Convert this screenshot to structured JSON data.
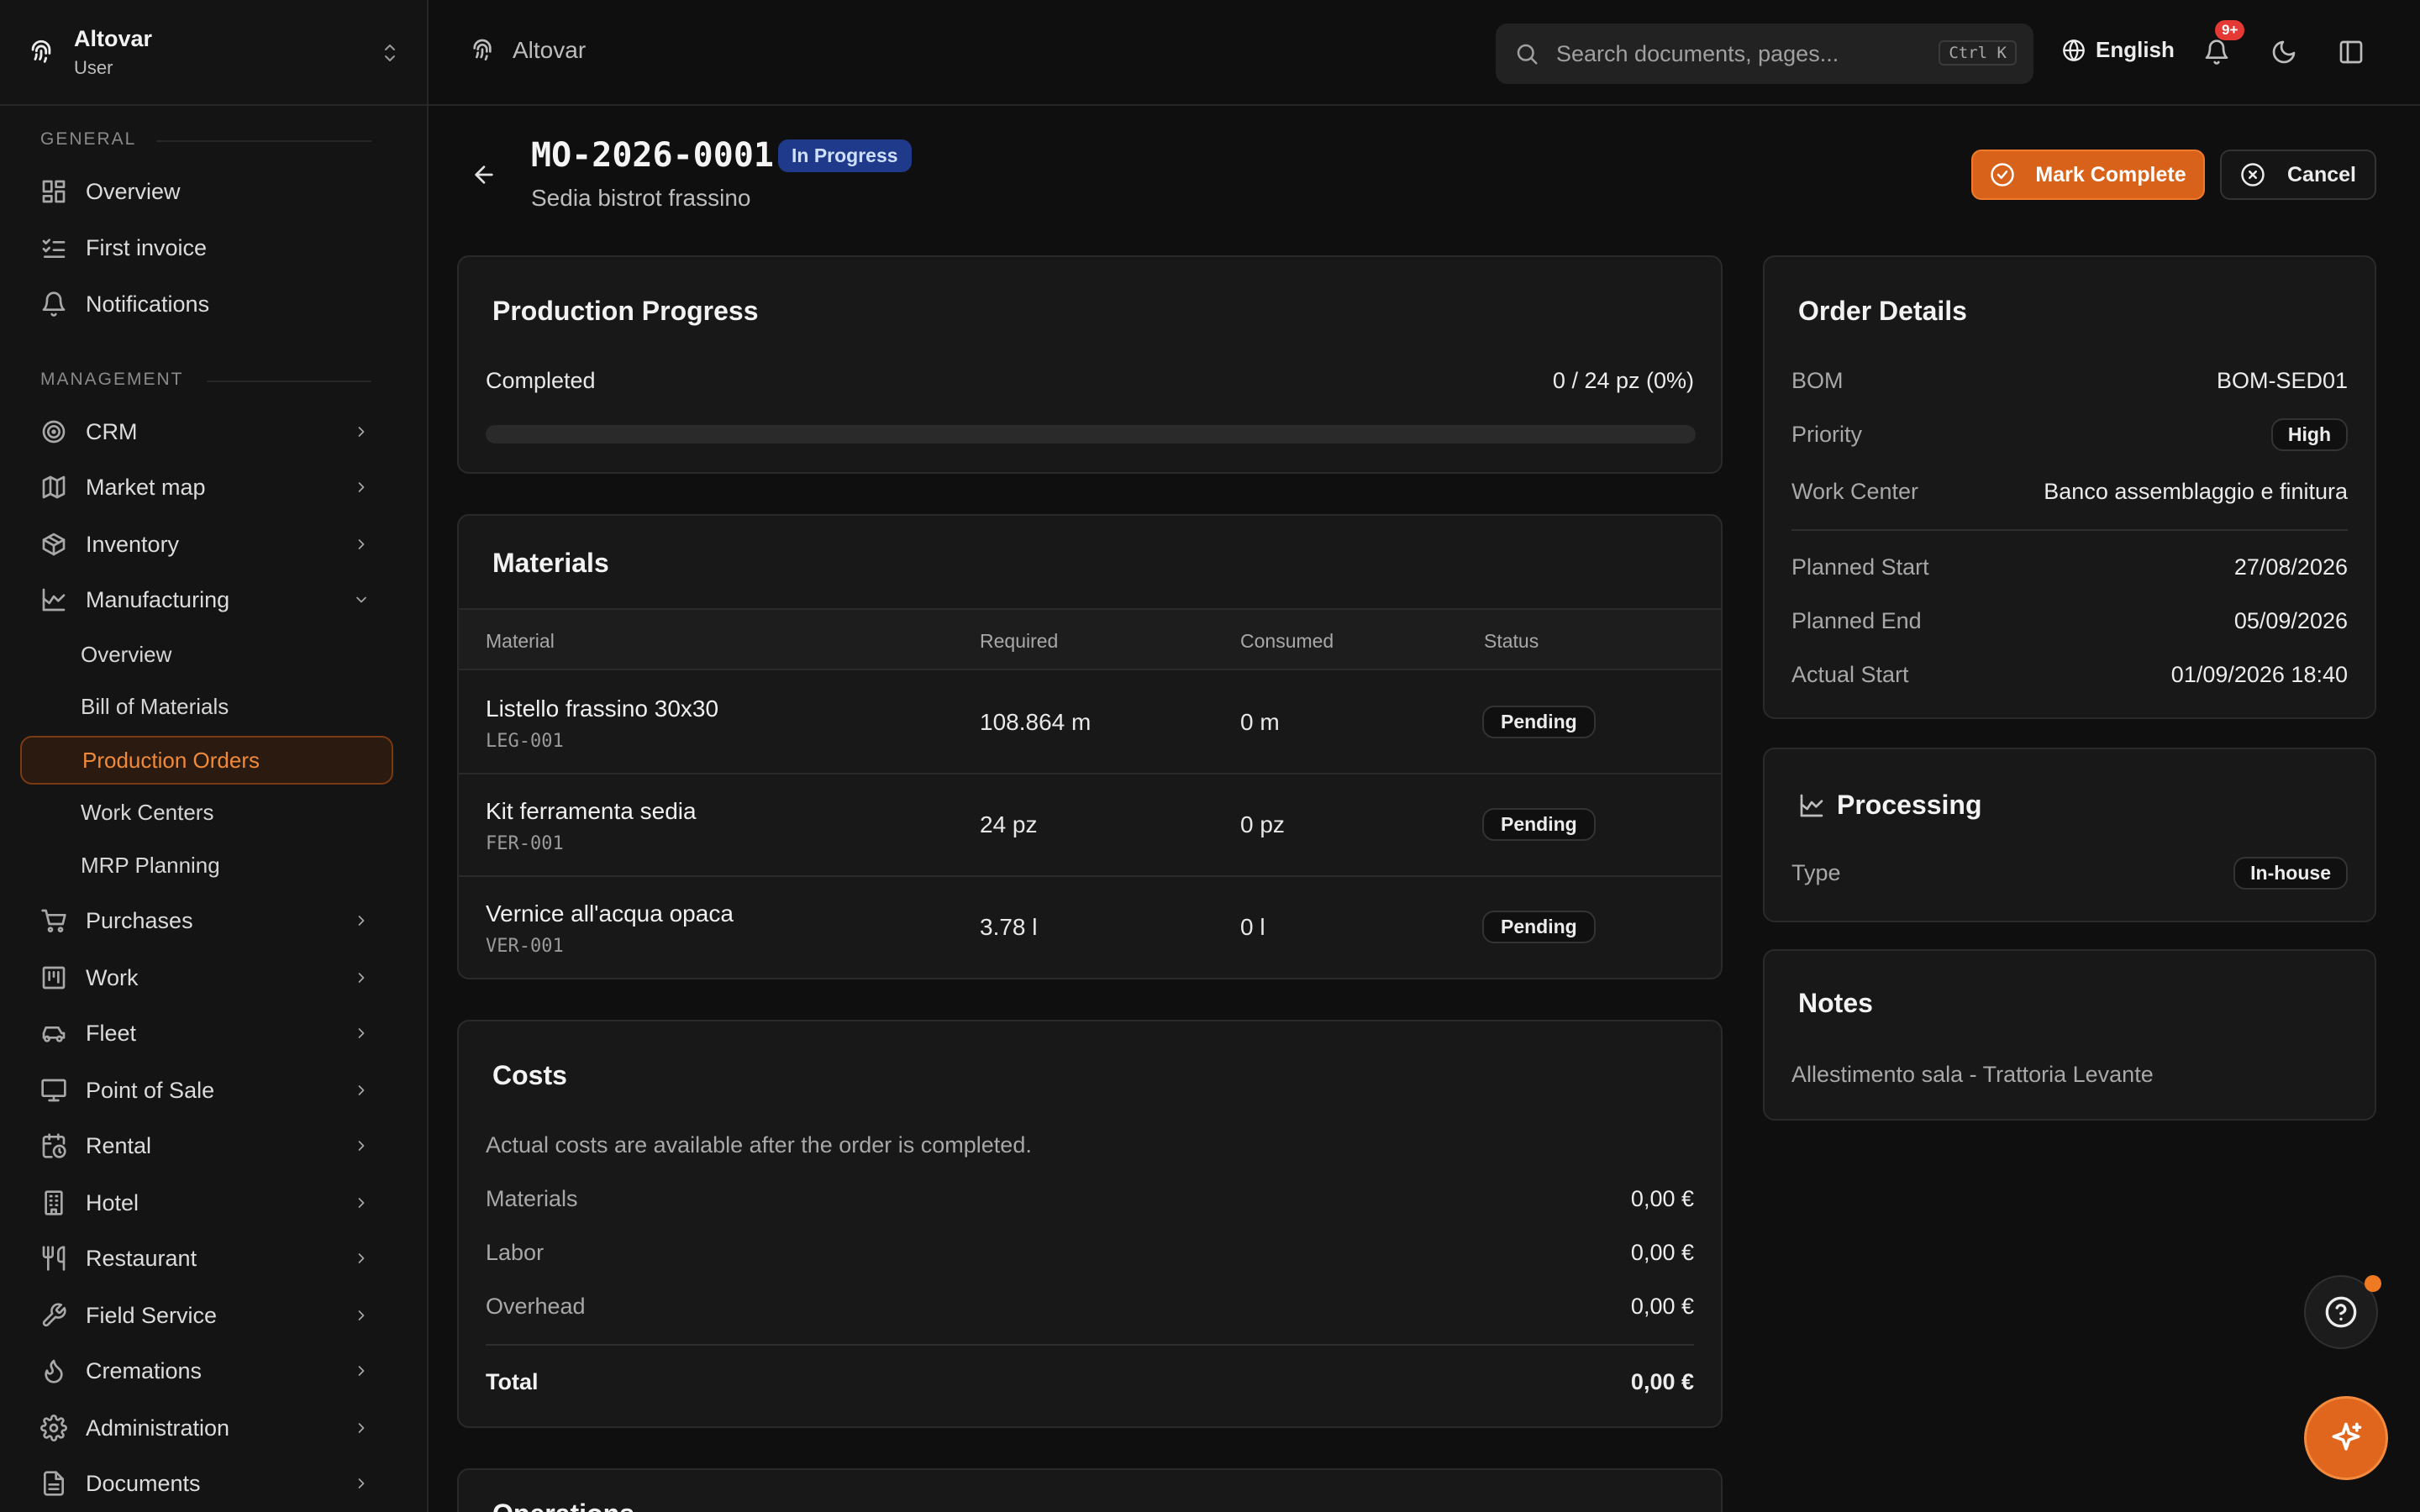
{
  "sidebar": {
    "brand_name": "Altovar",
    "brand_role": "User",
    "general_label": "GENERAL",
    "management_label": "MANAGEMENT",
    "general_items": [
      {
        "label": "Overview",
        "icon": "dashboard-icon"
      },
      {
        "label": "First invoice",
        "icon": "checklist-icon"
      },
      {
        "label": "Notifications",
        "icon": "bell-icon"
      }
    ],
    "management_items": [
      {
        "label": "CRM",
        "icon": "target-icon"
      },
      {
        "label": "Market map",
        "icon": "map-icon"
      },
      {
        "label": "Inventory",
        "icon": "box-icon"
      },
      {
        "label": "Manufacturing",
        "icon": "factory-icon",
        "expanded": true
      },
      {
        "label": "Purchases",
        "icon": "cart-icon"
      },
      {
        "label": "Work",
        "icon": "kanban-icon"
      },
      {
        "label": "Fleet",
        "icon": "car-icon"
      },
      {
        "label": "Point of Sale",
        "icon": "monitor-icon"
      },
      {
        "label": "Rental",
        "icon": "calendar-clock-icon"
      },
      {
        "label": "Hotel",
        "icon": "building-icon"
      },
      {
        "label": "Restaurant",
        "icon": "utensils-icon"
      },
      {
        "label": "Field Service",
        "icon": "wrench-icon"
      },
      {
        "label": "Cremations",
        "icon": "flame-icon"
      },
      {
        "label": "Administration",
        "icon": "gear-icon"
      },
      {
        "label": "Documents",
        "icon": "file-icon"
      }
    ],
    "manufacturing_sub": [
      {
        "label": "Overview"
      },
      {
        "label": "Bill of Materials"
      },
      {
        "label": "Production Orders",
        "active": true
      },
      {
        "label": "Work Centers"
      },
      {
        "label": "MRP Planning"
      }
    ]
  },
  "topbar": {
    "breadcrumb": "Altovar",
    "search_placeholder": "Search documents, pages...",
    "search_shortcut": "Ctrl K",
    "language": "English",
    "notif_badge": "9+"
  },
  "header": {
    "order_number": "MO-2026-0001",
    "status": "In Progress",
    "product": "Sedia bistrot frassino",
    "mark_complete_label": "Mark Complete",
    "cancel_label": "Cancel"
  },
  "progress": {
    "title": "Production Progress",
    "label": "Completed",
    "value": "0 / 24 pz (0%)",
    "percent": 0
  },
  "materials": {
    "title": "Materials",
    "columns": [
      "Material",
      "Required",
      "Consumed",
      "Status"
    ],
    "rows": [
      {
        "name": "Listello frassino 30x30",
        "code": "LEG-001",
        "required": "108.864 m",
        "consumed": "0 m",
        "status": "Pending"
      },
      {
        "name": "Kit ferramenta sedia",
        "code": "FER-001",
        "required": "24 pz",
        "consumed": "0 pz",
        "status": "Pending"
      },
      {
        "name": "Vernice all'acqua opaca",
        "code": "VER-001",
        "required": "3.78 l",
        "consumed": "0 l",
        "status": "Pending"
      }
    ]
  },
  "costs": {
    "title": "Costs",
    "note": "Actual costs are available after the order is completed.",
    "rows": [
      {
        "label": "Materials",
        "value": "0,00 €"
      },
      {
        "label": "Labor",
        "value": "0,00 €"
      },
      {
        "label": "Overhead",
        "value": "0,00 €"
      }
    ],
    "total_label": "Total",
    "total_value": "0,00 €"
  },
  "operations": {
    "title": "Operations"
  },
  "order_details": {
    "title": "Order Details",
    "bom_label": "BOM",
    "bom_value": "BOM-SED01",
    "priority_label": "Priority",
    "priority_value": "High",
    "work_center_label": "Work Center",
    "work_center_value": "Banco assemblaggio e finitura",
    "planned_start_label": "Planned Start",
    "planned_start_value": "27/08/2026",
    "planned_end_label": "Planned End",
    "planned_end_value": "05/09/2026",
    "actual_start_label": "Actual Start",
    "actual_start_value": "01/09/2026 18:40"
  },
  "processing": {
    "title": "Processing",
    "type_label": "Type",
    "type_value": "In-house"
  },
  "notes": {
    "title": "Notes",
    "text": "Allestimento sala - Trattoria Levante"
  },
  "colors": {
    "accent": "#d9621b",
    "status_blue": "#1f3a8a",
    "badge_red": "#e53935"
  }
}
